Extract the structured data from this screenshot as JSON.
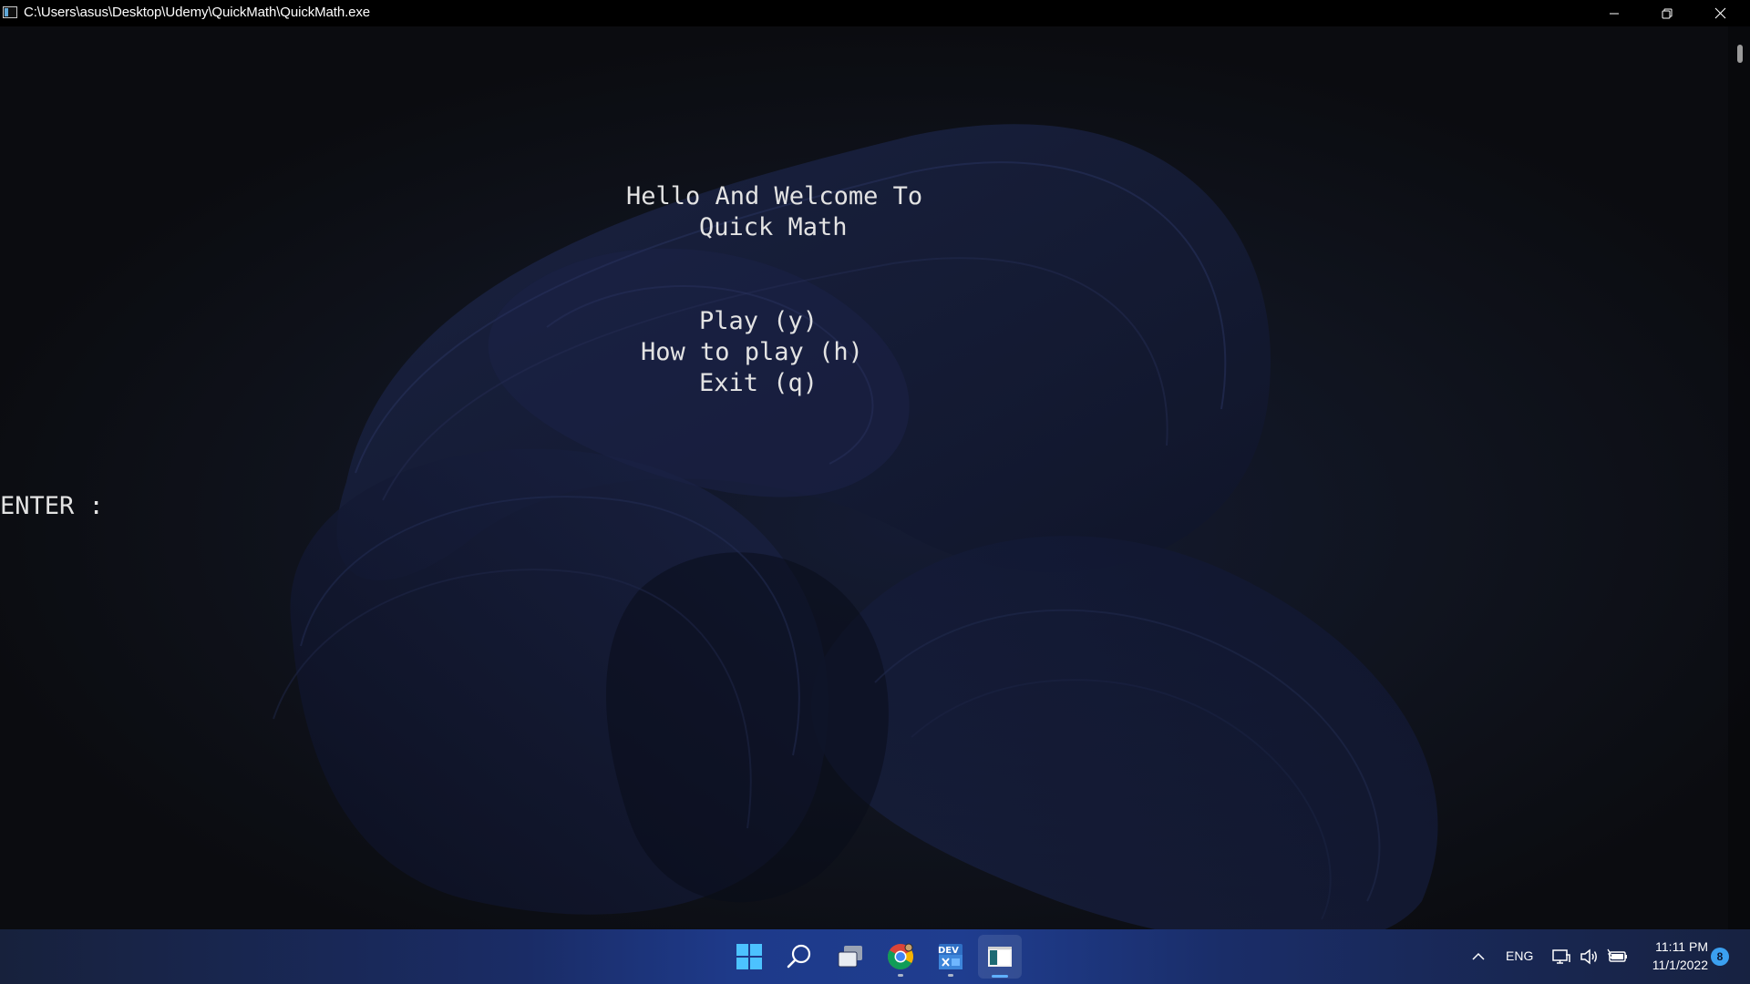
{
  "window": {
    "title": "C:\\Users\\asus\\Desktop\\Udemy\\QuickMath\\QuickMath.exe"
  },
  "console": {
    "welcome_line1": "Hello And Welcome To",
    "welcome_line2": "Quick Math",
    "menu": [
      "Play (y)",
      "How to play (h)",
      "Exit (q)"
    ],
    "prompt": "ENTER :"
  },
  "taskbar": {
    "apps": [
      {
        "name": "Start",
        "icon": "windows-logo-icon"
      },
      {
        "name": "Search",
        "icon": "search-icon"
      },
      {
        "name": "Task View",
        "icon": "task-view-icon"
      },
      {
        "name": "Google Chrome",
        "icon": "chrome-icon"
      },
      {
        "name": "Dev-C++",
        "icon": "dev-cpp-icon"
      },
      {
        "name": "Console",
        "icon": "console-app-icon"
      }
    ],
    "dev_label": "DEV",
    "language": "ENG",
    "time": "11:11 PM",
    "date": "11/1/2022",
    "notification_count": "8"
  },
  "colors": {
    "titlebar_bg": "#000000",
    "console_text": "#e3e3e3",
    "console_bg": "#0d0f15",
    "taskbar_accent": "#1e3a8a",
    "notification_badge": "#3ba0f0"
  }
}
